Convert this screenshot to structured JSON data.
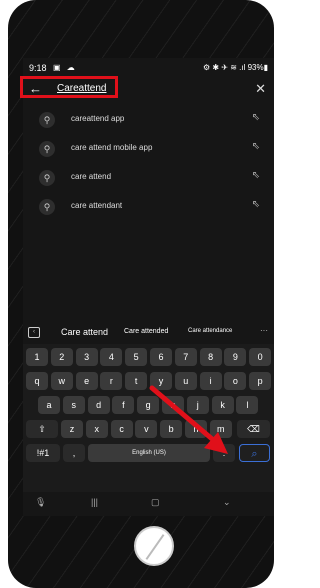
{
  "status": {
    "time": "9:18",
    "battery": "93%"
  },
  "search": {
    "query": "Careattend"
  },
  "suggestions": [
    "careattend app",
    "care attend mobile app",
    "care attend",
    "care attendant"
  ],
  "predictions": [
    "Care attend",
    "Care attended",
    "Care attendance",
    "···"
  ],
  "keyboard": {
    "row1": [
      "1",
      "2",
      "3",
      "4",
      "5",
      "6",
      "7",
      "8",
      "9",
      "0"
    ],
    "row2": [
      "q",
      "w",
      "e",
      "r",
      "t",
      "y",
      "u",
      "i",
      "o",
      "p"
    ],
    "row3": [
      "a",
      "s",
      "d",
      "f",
      "g",
      "h",
      "j",
      "k",
      "l"
    ],
    "row4": [
      "z",
      "x",
      "c",
      "v",
      "b",
      "n",
      "m"
    ],
    "symbols_label": "!#1",
    "comma_label": ",",
    "space_label": "English (US)",
    "period_label": ".",
    "shift_icon": "⇧",
    "backspace_icon": "⌫",
    "search_icon": "⌕"
  },
  "colors": {
    "highlight": "#e0101a",
    "search_key": "#3b6fd6"
  }
}
